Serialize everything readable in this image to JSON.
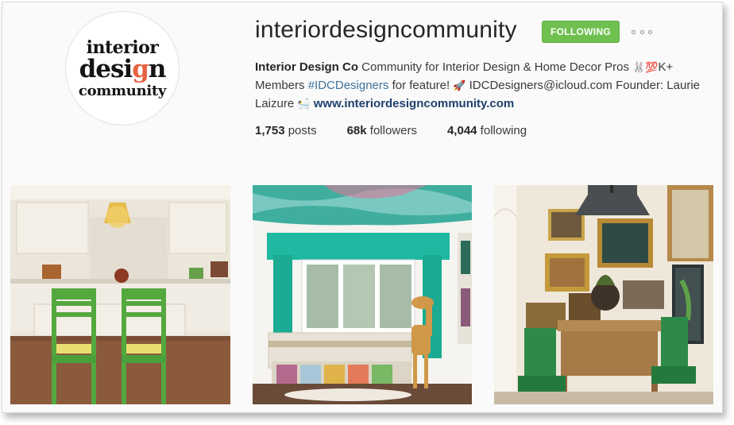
{
  "profile": {
    "avatar_line1": "interior",
    "avatar_line2_a": "desi",
    "avatar_line2_b": "g",
    "avatar_line2_c": "n",
    "avatar_line3": "community",
    "username": "interiordesigncommunity",
    "follow_label": "FOLLOWING",
    "more_icon": "ellipsis-icon",
    "accent_color": "#70c050"
  },
  "bio": {
    "name": "Interior Design Co",
    "text1": " Community for Interior Design & Home Decor Pros ",
    "emoji_bunny": "🐰",
    "emoji_100": "💯",
    "text2": "K+ Members ",
    "hashtag": "#IDCDesigners",
    "text3": " for feature! ",
    "emoji_rocket": "🚀",
    "text4": " IDCDesigners@icloud.com ",
    "emoji_box": "",
    "text5": " Founder: Laurie Laizure ",
    "emoji_bath": "🛀",
    "link": "www.interiordesigncommunity.com"
  },
  "stats": {
    "posts_count": "1,753",
    "posts_label": " posts",
    "followers_count": "68k",
    "followers_label": " followers",
    "following_count": "4,044",
    "following_label": " following"
  },
  "posts": [
    {
      "subject": "kitchen-with-green-chairs"
    },
    {
      "subject": "turquoise-nursery-with-giraffe"
    },
    {
      "subject": "gallery-wall-dining-nook"
    }
  ]
}
